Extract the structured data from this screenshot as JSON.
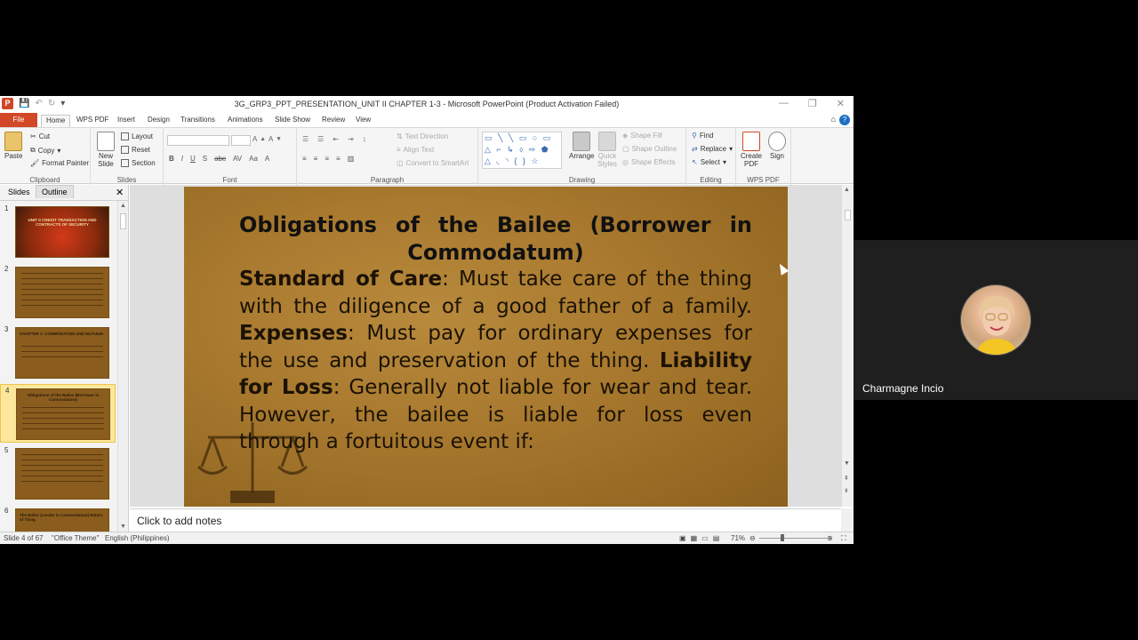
{
  "window": {
    "title": "3G_GRP3_PPT_PRESENTATION_UNIT II CHAPTER 1-3 - Microsoft PowerPoint (Product Activation Failed)"
  },
  "tabs": [
    "File",
    "Home",
    "WPS PDF",
    "Insert",
    "Design",
    "Transitions",
    "Animations",
    "Slide Show",
    "Review",
    "View"
  ],
  "ribbon": {
    "clipboard": {
      "paste": "Paste",
      "cut": "Cut",
      "copy": "Copy",
      "format_painter": "Format Painter",
      "label": "Clipboard"
    },
    "slides": {
      "new_slide": "New Slide",
      "layout": "Layout",
      "reset": "Reset",
      "section": "Section",
      "label": "Slides"
    },
    "font": {
      "label": "Font",
      "buttons": [
        "B",
        "I",
        "U",
        "S",
        "abc",
        "AV",
        "Aa",
        "A"
      ]
    },
    "paragraph": {
      "label": "Paragraph",
      "text_direction": "Text Direction",
      "align_text": "Align Text",
      "convert_smartart": "Convert to SmartArt"
    },
    "drawing": {
      "label": "Drawing",
      "arrange": "Arrange",
      "quick_styles": "Quick Styles",
      "shape_fill": "Shape Fill",
      "shape_outline": "Shape Outline",
      "shape_effects": "Shape Effects"
    },
    "editing": {
      "label": "Editing",
      "find": "Find",
      "replace": "Replace",
      "select": "Select"
    },
    "wps": {
      "label": "WPS PDF",
      "create_pdf": "Create PDF",
      "sign": "Sign"
    }
  },
  "pane": {
    "tab_slides": "Slides",
    "tab_outline": "Outline",
    "close": "✕",
    "thumbnails": [
      {
        "num": "1",
        "text": "UNIT II CREDIT TRANSACTION AND CONTRACTS OF SECURITY"
      },
      {
        "num": "2",
        "text": ""
      },
      {
        "num": "3",
        "text": "CHAPTER 1: COMMODATUM AND MUTUUM"
      },
      {
        "num": "4",
        "text": "Obligations of the Bailee (Borrower in Commodatum)"
      },
      {
        "num": "5",
        "text": ""
      },
      {
        "num": "6",
        "text": "The Bailor (Lender in Commodatum) Return of Thing"
      }
    ]
  },
  "slide": {
    "title": "Obligations of the Bailee (Borrower in Commodatum)",
    "items": [
      {
        "term": "Standard of Care",
        "text": ": Must take care of the thing with the diligence of a good father of a family."
      },
      {
        "term": "Expenses",
        "text": ": Must pay for ordinary expenses for the use and preservation of the thing."
      },
      {
        "term": "Liability for Loss",
        "text": ": Generally not liable for wear and tear. However, the bailee is liable for loss even through a fortuitous event if:"
      }
    ]
  },
  "notes": {
    "placeholder": "Click to add notes"
  },
  "status": {
    "slide_info": "Slide 4 of 67",
    "theme": "\"Office Theme\"",
    "language": "English (Philippines)",
    "zoom": "71%"
  },
  "video": {
    "participant_name": "Charmagne Incio"
  },
  "colors": {
    "file_tab": "#d24726",
    "slide_bg": "#a97a2f",
    "selected_thumb": "#fce79c"
  }
}
